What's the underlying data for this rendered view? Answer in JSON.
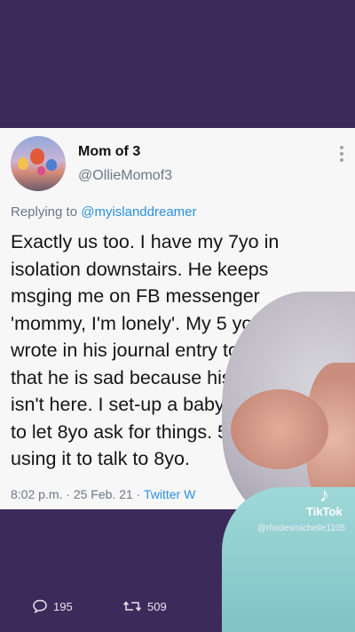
{
  "tweet": {
    "display_name": "Mom of 3",
    "handle": "@OllieMomof3",
    "replying_prefix": "Replying to ",
    "replying_to": "@myislanddreamer",
    "lines": [
      "Exactly us too. I have my 7yo in",
      "isolation downstairs. He keeps",
      "msging me on FB messenger",
      "'mommy, I'm lonely'. My 5 yo",
      "wrote in his journal entry today",
      "that he is sad because his broth",
      "isn't here. I set-up a baby monit",
      "to let 8yo ask for things. 5 y",
      "using it to talk to 8yo."
    ],
    "time": "8:02 p.m.",
    "date": "25 Feb. 21",
    "source": "Twitter W",
    "separator": " · "
  },
  "stats": {
    "replies": "195",
    "retweets": "509"
  },
  "watermark": {
    "brand": "TikTok",
    "username": "@rhodesmichelle1105"
  },
  "icons": {
    "more": "more-vertical-icon",
    "reply": "reply-bubble-icon",
    "retweet": "retweet-icon",
    "tiktok": "tiktok-note-icon"
  },
  "colors": {
    "background": "#3c2b5a",
    "card": "#f7f7f8",
    "link": "#2b8fe0",
    "muted": "#6b7785"
  }
}
